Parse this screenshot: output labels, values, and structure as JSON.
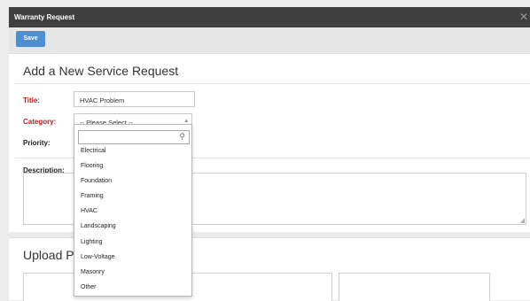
{
  "window": {
    "title": "Warranty Request",
    "close_label": "✕"
  },
  "toolbar": {
    "save_label": "Save"
  },
  "form": {
    "heading": "Add a New Service Request",
    "title_label": "Title:",
    "title_value": "HVAC Problem",
    "category_label": "Category:",
    "category_value": "-- Please Select --",
    "priority_label": "Priority:",
    "description_label": "Description:"
  },
  "category_dropdown": {
    "search_value": "",
    "options": [
      "Electrical",
      "Flooring",
      "Foundation",
      "Framing",
      "HVAC",
      "Landscaping",
      "Lighting",
      "Low-Voltage",
      "Masonry",
      "Other"
    ]
  },
  "upload": {
    "heading": "Upload Pi"
  },
  "colors": {
    "titlebar": "#404040",
    "save_button": "#4f8ed0",
    "required_label": "#b02020"
  },
  "icons": {
    "close": "close-icon",
    "search": "search-icon",
    "select_arrow": "chevron-up-icon",
    "resize": "resize-grip-icon"
  }
}
